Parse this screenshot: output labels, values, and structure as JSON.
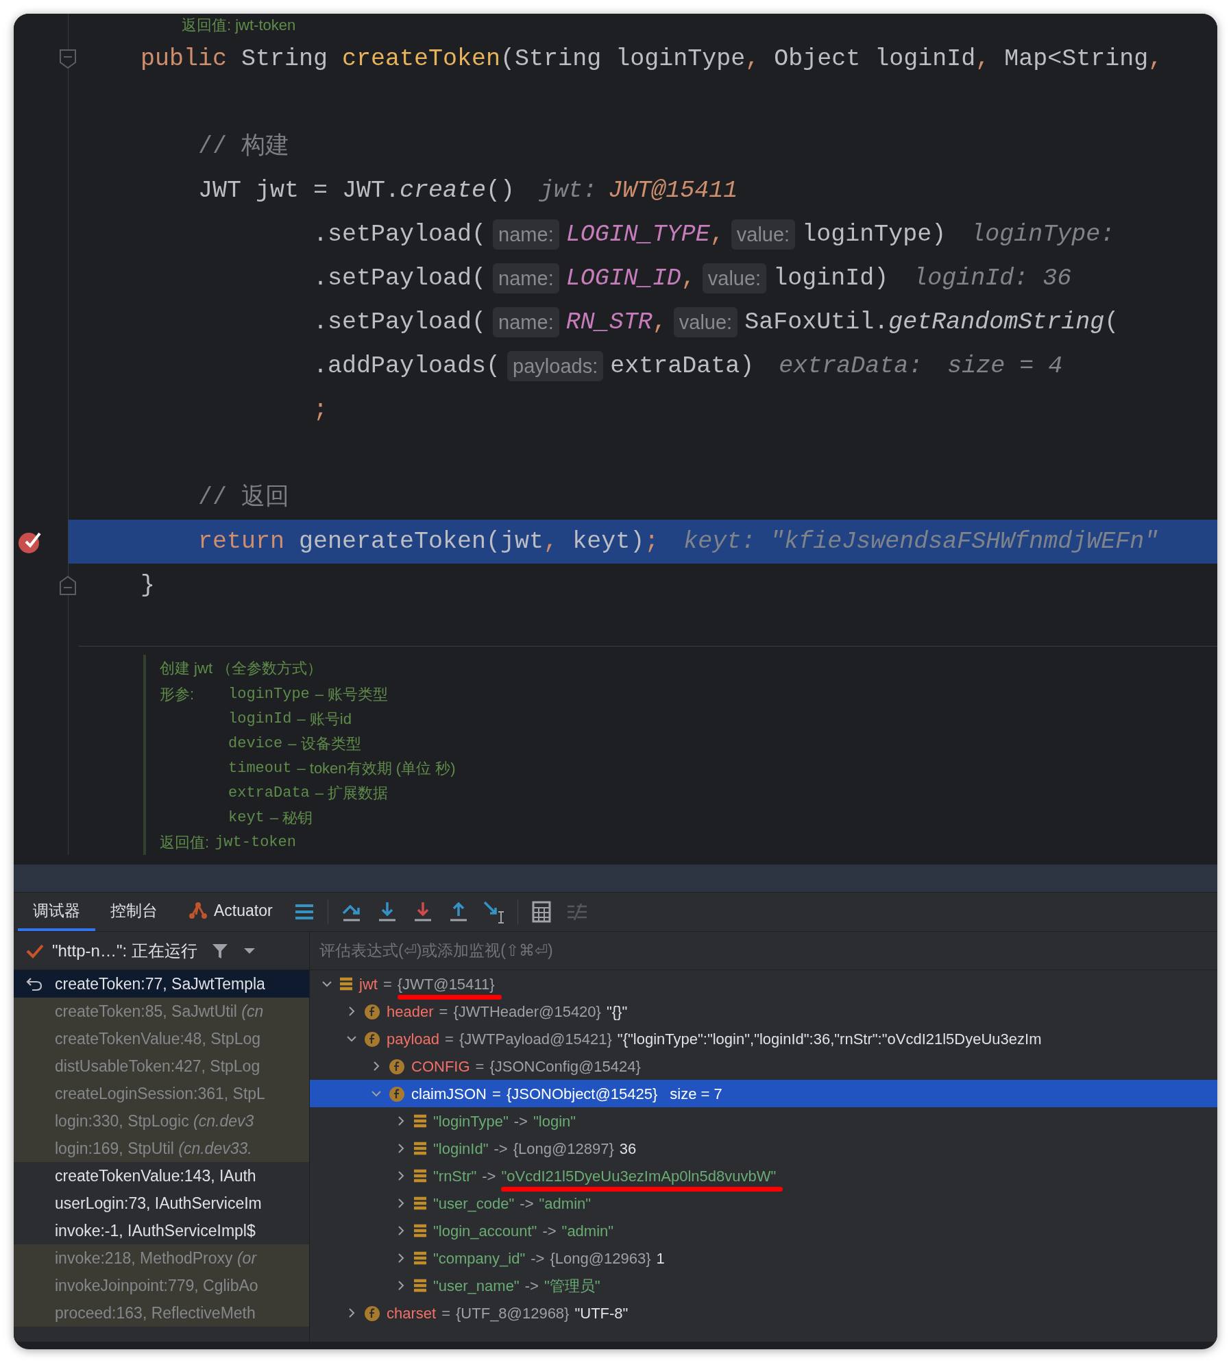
{
  "editor": {
    "top_doc_line": "返回值: jwt-token",
    "code_lines": [
      {
        "current": false,
        "kind": "fold-start",
        "tokens": [
          {
            "t": "public",
            "kind": "kw"
          },
          {
            "t": " String ",
            "kind": "plain"
          },
          {
            "t": "createToken",
            "kind": "decl"
          },
          {
            "t": "(String loginType",
            "kind": "plain"
          },
          {
            "t": ",",
            "kind": "punct"
          },
          {
            "t": " Object loginId",
            "kind": "plain"
          },
          {
            "t": ",",
            "kind": "punct"
          },
          {
            "t": " Map<String",
            "kind": "plain"
          },
          {
            "t": ",",
            "kind": "punct"
          }
        ]
      },
      {
        "current": false
      },
      {
        "current": false,
        "tokens": [
          {
            "t": "    // 构建",
            "kind": "comment"
          }
        ]
      },
      {
        "current": false,
        "tokens": [
          {
            "t": "    JWT jwt = JWT.",
            "kind": "plain"
          },
          {
            "t": "create",
            "kind": "italic"
          },
          {
            "t": "()",
            "kind": "plain"
          },
          {
            "t": "jwt:",
            "kind": "debug"
          },
          {
            "t": "JWT@15411",
            "kind": "debug-ref"
          }
        ]
      },
      {
        "current": false,
        "tokens": [
          {
            "t": "            .setPayload(",
            "kind": "plain"
          },
          {
            "t": "name:",
            "kind": "hint"
          },
          {
            "t": "LOGIN_TYPE",
            "kind": "const"
          },
          {
            "t": ",",
            "kind": "punct"
          },
          {
            "t": "value:",
            "kind": "hint"
          },
          {
            "t": "loginType)",
            "kind": "plain"
          },
          {
            "t": "loginType:",
            "kind": "debug"
          }
        ]
      },
      {
        "current": false,
        "tokens": [
          {
            "t": "            .setPayload(",
            "kind": "plain"
          },
          {
            "t": "name:",
            "kind": "hint"
          },
          {
            "t": "LOGIN_ID",
            "kind": "const"
          },
          {
            "t": ",",
            "kind": "punct"
          },
          {
            "t": "value:",
            "kind": "hint"
          },
          {
            "t": "loginId)",
            "kind": "plain"
          },
          {
            "t": "loginId: 36",
            "kind": "debug"
          }
        ]
      },
      {
        "current": false,
        "tokens": [
          {
            "t": "            .setPayload(",
            "kind": "plain"
          },
          {
            "t": "name:",
            "kind": "hint"
          },
          {
            "t": "RN_STR",
            "kind": "const"
          },
          {
            "t": ",",
            "kind": "punct"
          },
          {
            "t": "value:",
            "kind": "hint"
          },
          {
            "t": "SaFoxUtil.",
            "kind": "plain"
          },
          {
            "t": "getRandomString",
            "kind": "italic"
          },
          {
            "t": "(",
            "kind": "plain"
          }
        ]
      },
      {
        "current": false,
        "tokens": [
          {
            "t": "            .addPayloads(",
            "kind": "plain"
          },
          {
            "t": "payloads:",
            "kind": "hint"
          },
          {
            "t": "extraData)",
            "kind": "plain"
          },
          {
            "t": "extraData:",
            "kind": "debug"
          },
          {
            "t": "size = 4",
            "kind": "debug"
          }
        ]
      },
      {
        "current": false,
        "tokens": [
          {
            "t": "            ;",
            "kind": "punct"
          }
        ]
      },
      {
        "current": false
      },
      {
        "current": false,
        "tokens": [
          {
            "t": "    // 返回",
            "kind": "comment"
          }
        ]
      },
      {
        "current": true,
        "kind": "breakpoint",
        "tokens": [
          {
            "t": "    return",
            "kind": "kw"
          },
          {
            "t": " generateToken(jwt",
            "kind": "plain"
          },
          {
            "t": ",",
            "kind": "punct"
          },
          {
            "t": " keyt)",
            "kind": "plain"
          },
          {
            "t": ";",
            "kind": "punct"
          },
          {
            "t": "keyt: \"kfieJswendsaFSHWfnmdjWEFn\"",
            "kind": "debug"
          }
        ]
      },
      {
        "current": false,
        "kind": "fold-end",
        "tokens": [
          {
            "t": "}",
            "kind": "plain"
          }
        ]
      }
    ],
    "doc": {
      "title": "创建 jwt （全参数方式）",
      "params_label": "形参:",
      "params": [
        {
          "name": "loginType",
          "desc": "– 账号类型"
        },
        {
          "name": "loginId",
          "desc": "– 账号id"
        },
        {
          "name": "device",
          "desc": "– 设备类型"
        },
        {
          "name": "timeout",
          "desc": "– token有效期 (单位 秒)"
        },
        {
          "name": "extraData",
          "desc": "– 扩展数据"
        },
        {
          "name": "keyt",
          "desc": "– 秘钥"
        }
      ],
      "return_label": "返回值:",
      "return_value": "jwt-token"
    }
  },
  "debugger": {
    "tabs": [
      {
        "label": "调试器",
        "selected": true,
        "kind": "plain"
      },
      {
        "label": "控制台",
        "selected": false,
        "kind": "plain"
      },
      {
        "label": "Actuator",
        "selected": false,
        "kind": "plugin"
      }
    ],
    "actions": [
      {
        "kind": "frames",
        "disabled": false
      },
      {
        "kind": "step-over",
        "disabled": false
      },
      {
        "kind": "step-into",
        "disabled": false
      },
      {
        "kind": "force-step-into",
        "disabled": false
      },
      {
        "kind": "step-out",
        "disabled": false
      },
      {
        "kind": "run-to-cursor",
        "disabled": false
      },
      {
        "kind": "evaluate",
        "disabled": false
      },
      {
        "kind": "trace",
        "disabled": true
      }
    ],
    "thread": "\"http-n…\": 正在运行",
    "evaluate_placeholder": "评估表达式(⏎)或添加监视(⇧⌘⏎)",
    "frames": [
      {
        "text": "createToken:77, SaJwtTempla",
        "selected": true,
        "kind": "user"
      },
      {
        "text": "createToken:85, SaJwtUtil *(cn*",
        "selected": false,
        "kind": "library"
      },
      {
        "text": "createTokenValue:48, StpLog",
        "selected": false,
        "kind": "library"
      },
      {
        "text": "distUsableToken:427, StpLog",
        "selected": false,
        "kind": "library"
      },
      {
        "text": "createLoginSession:361, StpL",
        "selected": false,
        "kind": "library"
      },
      {
        "text": "login:330, StpLogic *(cn.dev3*",
        "selected": false,
        "kind": "library"
      },
      {
        "text": "login:169, StpUtil *(cn.dev33.*",
        "selected": false,
        "kind": "library"
      },
      {
        "text": "createTokenValue:143, IAuth",
        "selected": false,
        "kind": "user"
      },
      {
        "text": "userLogin:73, IAuthServiceIm",
        "selected": false,
        "kind": "user"
      },
      {
        "text": "invoke:-1, IAuthServiceImpl$",
        "selected": false,
        "kind": "user"
      },
      {
        "text": "invoke:218, MethodProxy *(or*",
        "selected": false,
        "kind": "library"
      },
      {
        "text": "invokeJoinpoint:779, CglibAo",
        "selected": false,
        "kind": "library"
      },
      {
        "text": "proceed:163, ReflectiveMeth",
        "selected": false,
        "kind": "library"
      }
    ],
    "variables": [
      {
        "kind": "local",
        "expanded": true,
        "selected": false,
        "parts": [
          {
            "t": "jwt",
            "kind": "name"
          },
          {
            "t": "=",
            "kind": "op"
          },
          {
            "t": "{JWT@15411}",
            "kind": "ref",
            "marked": true
          }
        ],
        "children": [
          {
            "kind": "field",
            "expanded": false,
            "selected": false,
            "parts": [
              {
                "t": "header",
                "kind": "name"
              },
              {
                "t": "=",
                "kind": "op"
              },
              {
                "t": "{JWTHeader@15420}",
                "kind": "ref",
                "marked": false
              },
              {
                "t": "\"{}\"",
                "kind": "plain"
              }
            ]
          },
          {
            "kind": "field",
            "expanded": true,
            "selected": false,
            "parts": [
              {
                "t": "payload",
                "kind": "name"
              },
              {
                "t": "=",
                "kind": "op"
              },
              {
                "t": "{JWTPayload@15421}",
                "kind": "ref",
                "marked": false
              },
              {
                "t": "\"{\"loginType\":\"login\",\"loginId\":36,\"rnStr\":\"oVcdI21l5DyeUu3ezIm",
                "kind": "plain"
              }
            ],
            "children": [
              {
                "kind": "field",
                "expanded": false,
                "selected": false,
                "parts": [
                  {
                    "t": "CONFIG",
                    "kind": "name"
                  },
                  {
                    "t": "=",
                    "kind": "op"
                  },
                  {
                    "t": "{JSONConfig@15424}",
                    "kind": "ref",
                    "marked": false
                  }
                ]
              },
              {
                "kind": "field",
                "expanded": true,
                "selected": true,
                "parts": [
                  {
                    "t": "claimJSON",
                    "kind": "name"
                  },
                  {
                    "t": "=",
                    "kind": "op"
                  },
                  {
                    "t": "{JSONObject@15425}",
                    "kind": "ref",
                    "marked": false
                  },
                  {
                    "t": "size = 7",
                    "kind": "plain"
                  }
                ],
                "children": [
                  {
                    "kind": "entry",
                    "expanded": false,
                    "selected": false,
                    "parts": [
                      {
                        "t": "\"loginType\"",
                        "kind": "str"
                      },
                      {
                        "t": "->",
                        "kind": "op"
                      },
                      {
                        "t": "\"login\"",
                        "kind": "str"
                      }
                    ]
                  },
                  {
                    "kind": "entry",
                    "expanded": false,
                    "selected": false,
                    "parts": [
                      {
                        "t": "\"loginId\"",
                        "kind": "str"
                      },
                      {
                        "t": "->",
                        "kind": "op"
                      },
                      {
                        "t": "{Long@12897}",
                        "kind": "ref",
                        "marked": false
                      },
                      {
                        "t": "36",
                        "kind": "plain"
                      }
                    ]
                  },
                  {
                    "kind": "entry",
                    "expanded": false,
                    "selected": false,
                    "parts": [
                      {
                        "t": "\"rnStr\"",
                        "kind": "str"
                      },
                      {
                        "t": "->",
                        "kind": "op"
                      },
                      {
                        "t": "\"oVcdI21l5DyeUu3ezImAp0ln5d8vuvbW\"",
                        "kind": "str",
                        "marked": true
                      }
                    ]
                  },
                  {
                    "kind": "entry",
                    "expanded": false,
                    "selected": false,
                    "parts": [
                      {
                        "t": "\"user_code\"",
                        "kind": "str"
                      },
                      {
                        "t": "->",
                        "kind": "op"
                      },
                      {
                        "t": "\"admin\"",
                        "kind": "str"
                      }
                    ]
                  },
                  {
                    "kind": "entry",
                    "expanded": false,
                    "selected": false,
                    "parts": [
                      {
                        "t": "\"login_account\"",
                        "kind": "str"
                      },
                      {
                        "t": "->",
                        "kind": "op"
                      },
                      {
                        "t": "\"admin\"",
                        "kind": "str"
                      }
                    ]
                  },
                  {
                    "kind": "entry",
                    "expanded": false,
                    "selected": false,
                    "parts": [
                      {
                        "t": "\"company_id\"",
                        "kind": "str"
                      },
                      {
                        "t": "->",
                        "kind": "op"
                      },
                      {
                        "t": "{Long@12963}",
                        "kind": "ref",
                        "marked": false
                      },
                      {
                        "t": "1",
                        "kind": "plain"
                      }
                    ]
                  },
                  {
                    "kind": "entry",
                    "expanded": false,
                    "selected": false,
                    "parts": [
                      {
                        "t": "\"user_name\"",
                        "kind": "str"
                      },
                      {
                        "t": "->",
                        "kind": "op"
                      },
                      {
                        "t": "\"管理员\"",
                        "kind": "str"
                      }
                    ]
                  }
                ]
              }
            ]
          },
          {
            "kind": "field",
            "expanded": false,
            "selected": false,
            "parts": [
              {
                "t": "charset",
                "kind": "name"
              },
              {
                "t": "=",
                "kind": "op"
              },
              {
                "t": "{UTF_8@12968}",
                "kind": "ref",
                "marked": false
              },
              {
                "t": "\"UTF-8\"",
                "kind": "plain"
              }
            ]
          }
        ]
      }
    ]
  }
}
